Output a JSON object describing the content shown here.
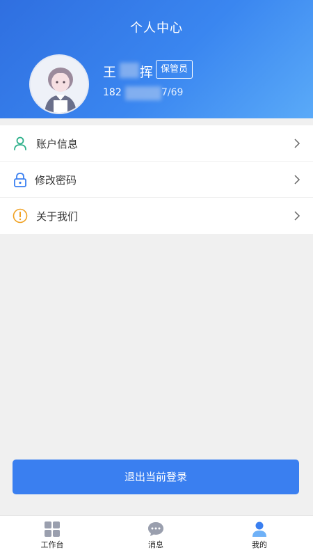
{
  "header": {
    "title": "个人中心",
    "user_name_first": "王",
    "user_name_last": "挥",
    "role": "保管员",
    "phone_prefix": "182",
    "phone_suffix": "7/69"
  },
  "menu": {
    "items": [
      {
        "label": "账户信息",
        "icon": "user-icon"
      },
      {
        "label": "修改密码",
        "icon": "lock-icon"
      },
      {
        "label": "关于我们",
        "icon": "info-icon"
      }
    ]
  },
  "logout": {
    "label": "退出当前登录"
  },
  "tabbar": {
    "items": [
      {
        "label": "工作台",
        "icon": "grid-icon"
      },
      {
        "label": "消息",
        "icon": "chat-icon"
      },
      {
        "label": "我的",
        "icon": "person-icon",
        "active": true
      }
    ]
  },
  "colors": {
    "header_gradient_start": "#2f6fe0",
    "header_gradient_end": "#5aaaf8",
    "accent": "#3a7ff0",
    "user_icon": "#2db08a",
    "lock_icon": "#3a7ff0",
    "info_icon": "#f0a020"
  }
}
